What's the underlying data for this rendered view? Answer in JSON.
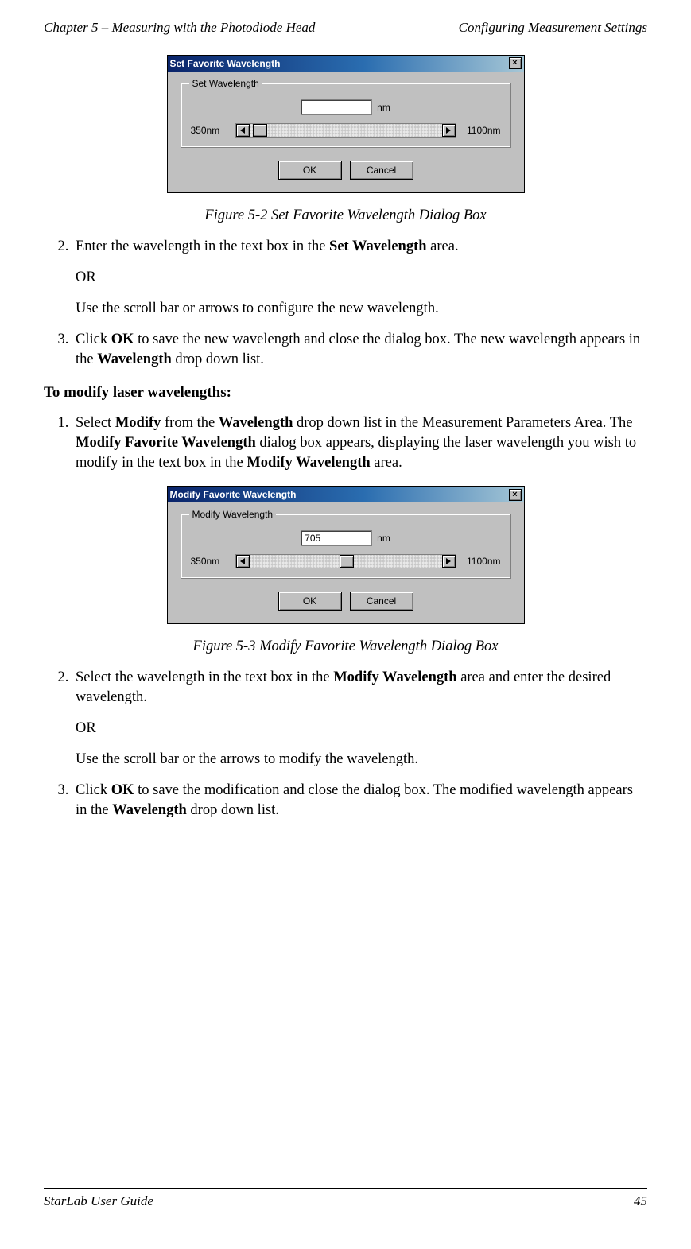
{
  "header": {
    "left": "Chapter 5 – Measuring with the Photodiode Head",
    "right": "Configuring Measurement Settings"
  },
  "dialog1": {
    "title": "Set Favorite Wavelength",
    "group": "Set Wavelength",
    "value": "",
    "unit": "nm",
    "min": "350nm",
    "max": "1100nm",
    "ok": "OK",
    "cancel": "Cancel",
    "thumb_pct": 2
  },
  "caption1": "Figure 5-2 Set Favorite Wavelength Dialog Box",
  "steps_a": {
    "s2a": "Enter the wavelength in the text box in the ",
    "s2b": "Set Wavelength",
    "s2c": " area.",
    "or": "OR",
    "s2d": "Use the scroll bar or arrows to configure the new wavelength.",
    "s3a": "Click ",
    "s3b": "OK",
    "s3c": " to save the new wavelength and close the dialog box. The new wavelength appears in the ",
    "s3d": "Wavelength",
    "s3e": " drop down list."
  },
  "heading2": "To modify laser wavelengths:",
  "steps_b": {
    "s1a": "Select ",
    "s1b": "Modify",
    "s1c": " from the ",
    "s1d": "Wavelength",
    "s1e": " drop down list in the Measurement Parameters Area. The ",
    "s1f": "Modify Favorite Wavelength",
    "s1g": " dialog box appears, displaying the laser wavelength you wish to modify in the text box in the ",
    "s1h": "Modify Wavelength",
    "s1i": " area."
  },
  "dialog2": {
    "title": "Modify Favorite Wavelength",
    "group": "Modify Wavelength",
    "value": "705",
    "unit": "nm",
    "min": "350nm",
    "max": "1100nm",
    "ok": "OK",
    "cancel": "Cancel",
    "thumb_pct": 47
  },
  "caption2": "Figure 5-3 Modify Favorite Wavelength Dialog Box",
  "steps_c": {
    "s2a": "Select the wavelength in the text box in the ",
    "s2b": "Modify Wavelength",
    "s2c": " area and enter the desired wavelength.",
    "or": "OR",
    "s2d": "Use the scroll bar or the arrows to modify the wavelength.",
    "s3a": "Click ",
    "s3b": "OK",
    "s3c": " to save the modification and close the dialog box. The modified wavelength appears in the ",
    "s3d": "Wavelength",
    "s3e": " drop down list."
  },
  "footer": {
    "left": "StarLab User Guide",
    "right": "45"
  }
}
